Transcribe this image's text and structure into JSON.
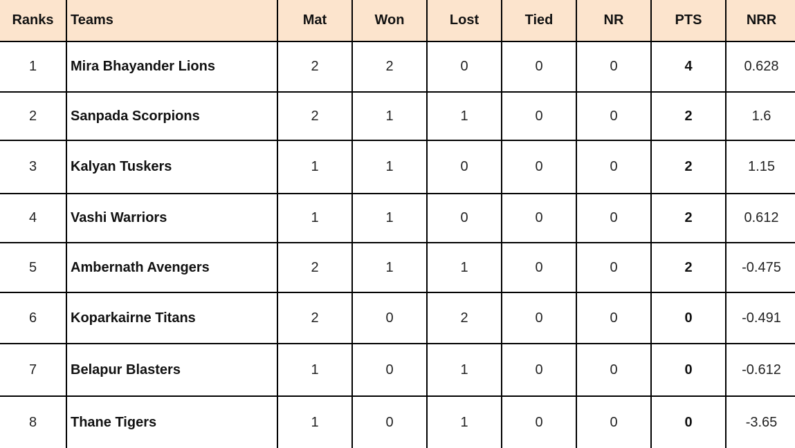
{
  "table": {
    "header_bg": "#fce4cd",
    "columns": {
      "rank": "Ranks",
      "team": "Teams",
      "mat": "Mat",
      "won": "Won",
      "lost": "Lost",
      "tied": "Tied",
      "nr": "NR",
      "pts": "PTS",
      "nrr": "NRR"
    },
    "rows": [
      {
        "rank": "1",
        "team": "Mira Bhayander Lions",
        "mat": "2",
        "won": "2",
        "lost": "0",
        "tied": "0",
        "nr": "0",
        "pts": "4",
        "nrr": "0.628"
      },
      {
        "rank": "2",
        "team": "Sanpada Scorpions",
        "mat": "2",
        "won": "1",
        "lost": "1",
        "tied": "0",
        "nr": "0",
        "pts": "2",
        "nrr": "1.6"
      },
      {
        "rank": "3",
        "team": "Kalyan Tuskers",
        "mat": "1",
        "won": "1",
        "lost": "0",
        "tied": "0",
        "nr": "0",
        "pts": "2",
        "nrr": "1.15"
      },
      {
        "rank": "4",
        "team": "Vashi Warriors",
        "mat": "1",
        "won": "1",
        "lost": "0",
        "tied": "0",
        "nr": "0",
        "pts": "2",
        "nrr": "0.612"
      },
      {
        "rank": "5",
        "team": "Ambernath Avengers",
        "mat": "2",
        "won": "1",
        "lost": "1",
        "tied": "0",
        "nr": "0",
        "pts": "2",
        "nrr": "-0.475"
      },
      {
        "rank": "6",
        "team": "Koparkairne Titans",
        "mat": "2",
        "won": "0",
        "lost": "2",
        "tied": "0",
        "nr": "0",
        "pts": "0",
        "nrr": "-0.491"
      },
      {
        "rank": "7",
        "team": "Belapur Blasters",
        "mat": "1",
        "won": "0",
        "lost": "1",
        "tied": "0",
        "nr": "0",
        "pts": "0",
        "nrr": "-0.612"
      },
      {
        "rank": "8",
        "team": "Thane Tigers",
        "mat": "1",
        "won": "0",
        "lost": "1",
        "tied": "0",
        "nr": "0",
        "pts": "0",
        "nrr": "-3.65"
      }
    ]
  }
}
